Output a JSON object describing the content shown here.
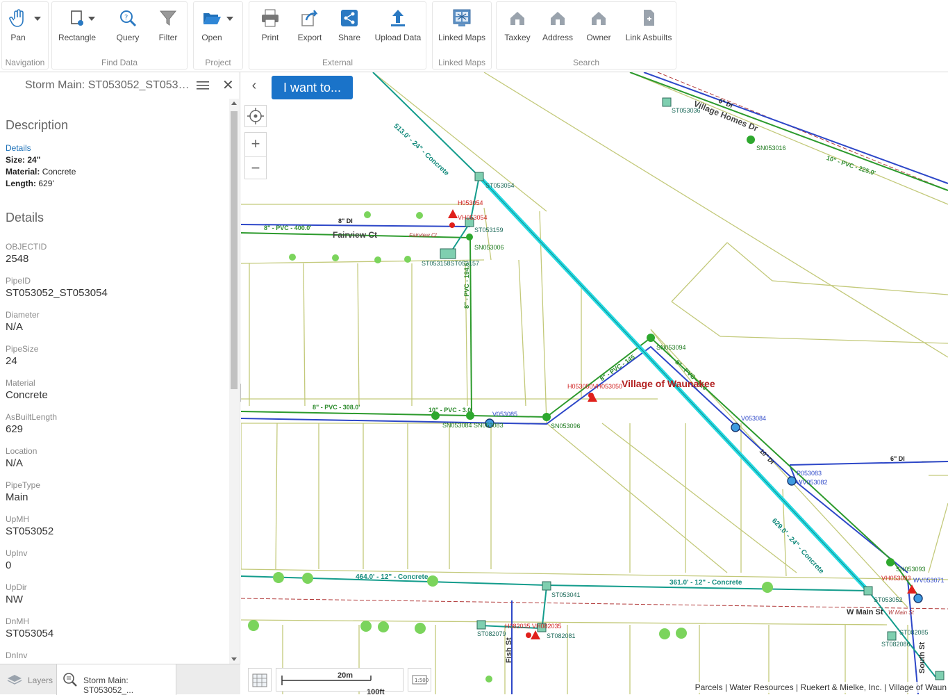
{
  "ribbon": {
    "groups": {
      "navigation": "Navigation",
      "find_data": "Find Data",
      "project": "Project",
      "external": "External",
      "linked_maps": "Linked Maps",
      "search": "Search"
    },
    "tools": {
      "pan": "Pan",
      "rectangle": "Rectangle",
      "query": "Query",
      "filter": "Filter",
      "open": "Open",
      "print": "Print",
      "export": "Export",
      "share": "Share",
      "upload": "Upload Data",
      "linked_maps": "Linked Maps",
      "taxkey": "Taxkey",
      "address": "Address",
      "owner": "Owner",
      "link_asbuilts": "Link Asbuilts"
    }
  },
  "panel": {
    "title": "Storm Main: ST053052_ST0530...",
    "description_title": "Description",
    "details_link": "Details",
    "size_label": "Size:",
    "size_value": "24\"",
    "material_label": "Material:",
    "material_value": "Concrete",
    "length_label": "Length:",
    "length_value": "629'",
    "details_title": "Details",
    "fields": [
      {
        "name": "OBJECTID",
        "value": "2548"
      },
      {
        "name": "PipeID",
        "value": "ST053052_ST053054"
      },
      {
        "name": "Diameter",
        "value": "N/A"
      },
      {
        "name": "PipeSize",
        "value": "24"
      },
      {
        "name": "Material",
        "value": "Concrete"
      },
      {
        "name": "AsBuiltLength",
        "value": "629"
      },
      {
        "name": "Location",
        "value": "N/A"
      },
      {
        "name": "PipeType",
        "value": "Main"
      },
      {
        "name": "UpMH",
        "value": "ST053052"
      },
      {
        "name": "UpInv",
        "value": "0"
      },
      {
        "name": "UpDir",
        "value": "NW"
      },
      {
        "name": "DnMH",
        "value": "ST053054"
      },
      {
        "name": "DnInv",
        "value": ""
      }
    ],
    "tabs": {
      "layers": "Layers",
      "storm": "Storm Main: ST053052_..."
    }
  },
  "map": {
    "i_want_to": "I want to...",
    "scale_top": "20m",
    "scale_bottom": "100ft",
    "attribution": "Parcels | Water Resources | Ruekert & Mielke, Inc. | Village of Waun",
    "village_label": "Village of Waunakee",
    "labels": {
      "fairview": "Fairview Ct",
      "fairview_small": "Fairview Ct",
      "w_main": "W Main St",
      "w_main_small": "W Main St",
      "fish": "Fish St",
      "south": "South St",
      "village_homes": "Village Homes Dr",
      "p_513": "513.0' - 24\" - Concrete",
      "p_629": "629.0' - 24\" - Concrete",
      "p_464": "464.0' - 12\" - Concrete",
      "p_361": "361.0' - 12\" - Concrete",
      "p_400": "8\" - PVC - 400.0'",
      "p_308": "8\" - PVC - 308.0'",
      "p_194": "8\" - PVC - 194.6'",
      "p_10pvc": "10\" - PVC - 3.0'",
      "p_8pvc145": "8\" - PVC - 145",
      "p_8pvc210": "8\" - PVC - 210",
      "p_10pvc_top": "10\" - PVC - 225.0'",
      "di_8": "8\" DI",
      "di_6a": "6\" DI",
      "di_6b": "6\" DI",
      "di_10": "10\" DI",
      "st053054": "ST053054",
      "st053159": "ST053159",
      "st053158": "ST053158ST053157",
      "sn053006": "SN053006",
      "h053054": "H053054",
      "vh053054": "VH053054",
      "sn053094": "SN053094",
      "sn053096": "SN053096",
      "h053050": "H053050VH053050",
      "v053085": "V053085",
      "sn053084": "SN053084 SN053083",
      "v053084": "V053084",
      "p053083": "P053083",
      "wv053082": "WV053082",
      "sn053093": "SN053093",
      "vh053093": "VH053093",
      "wv053071": "WV053071",
      "st053052": "ST053052",
      "st053041": "ST053041",
      "st082079": "ST082079",
      "st082081": "ST082081",
      "h082035": "H082035 VH082035",
      "st082085": "ST082085",
      "st082086": "ST082086",
      "st053036": "ST053036",
      "sn053016": "SN053016"
    }
  }
}
